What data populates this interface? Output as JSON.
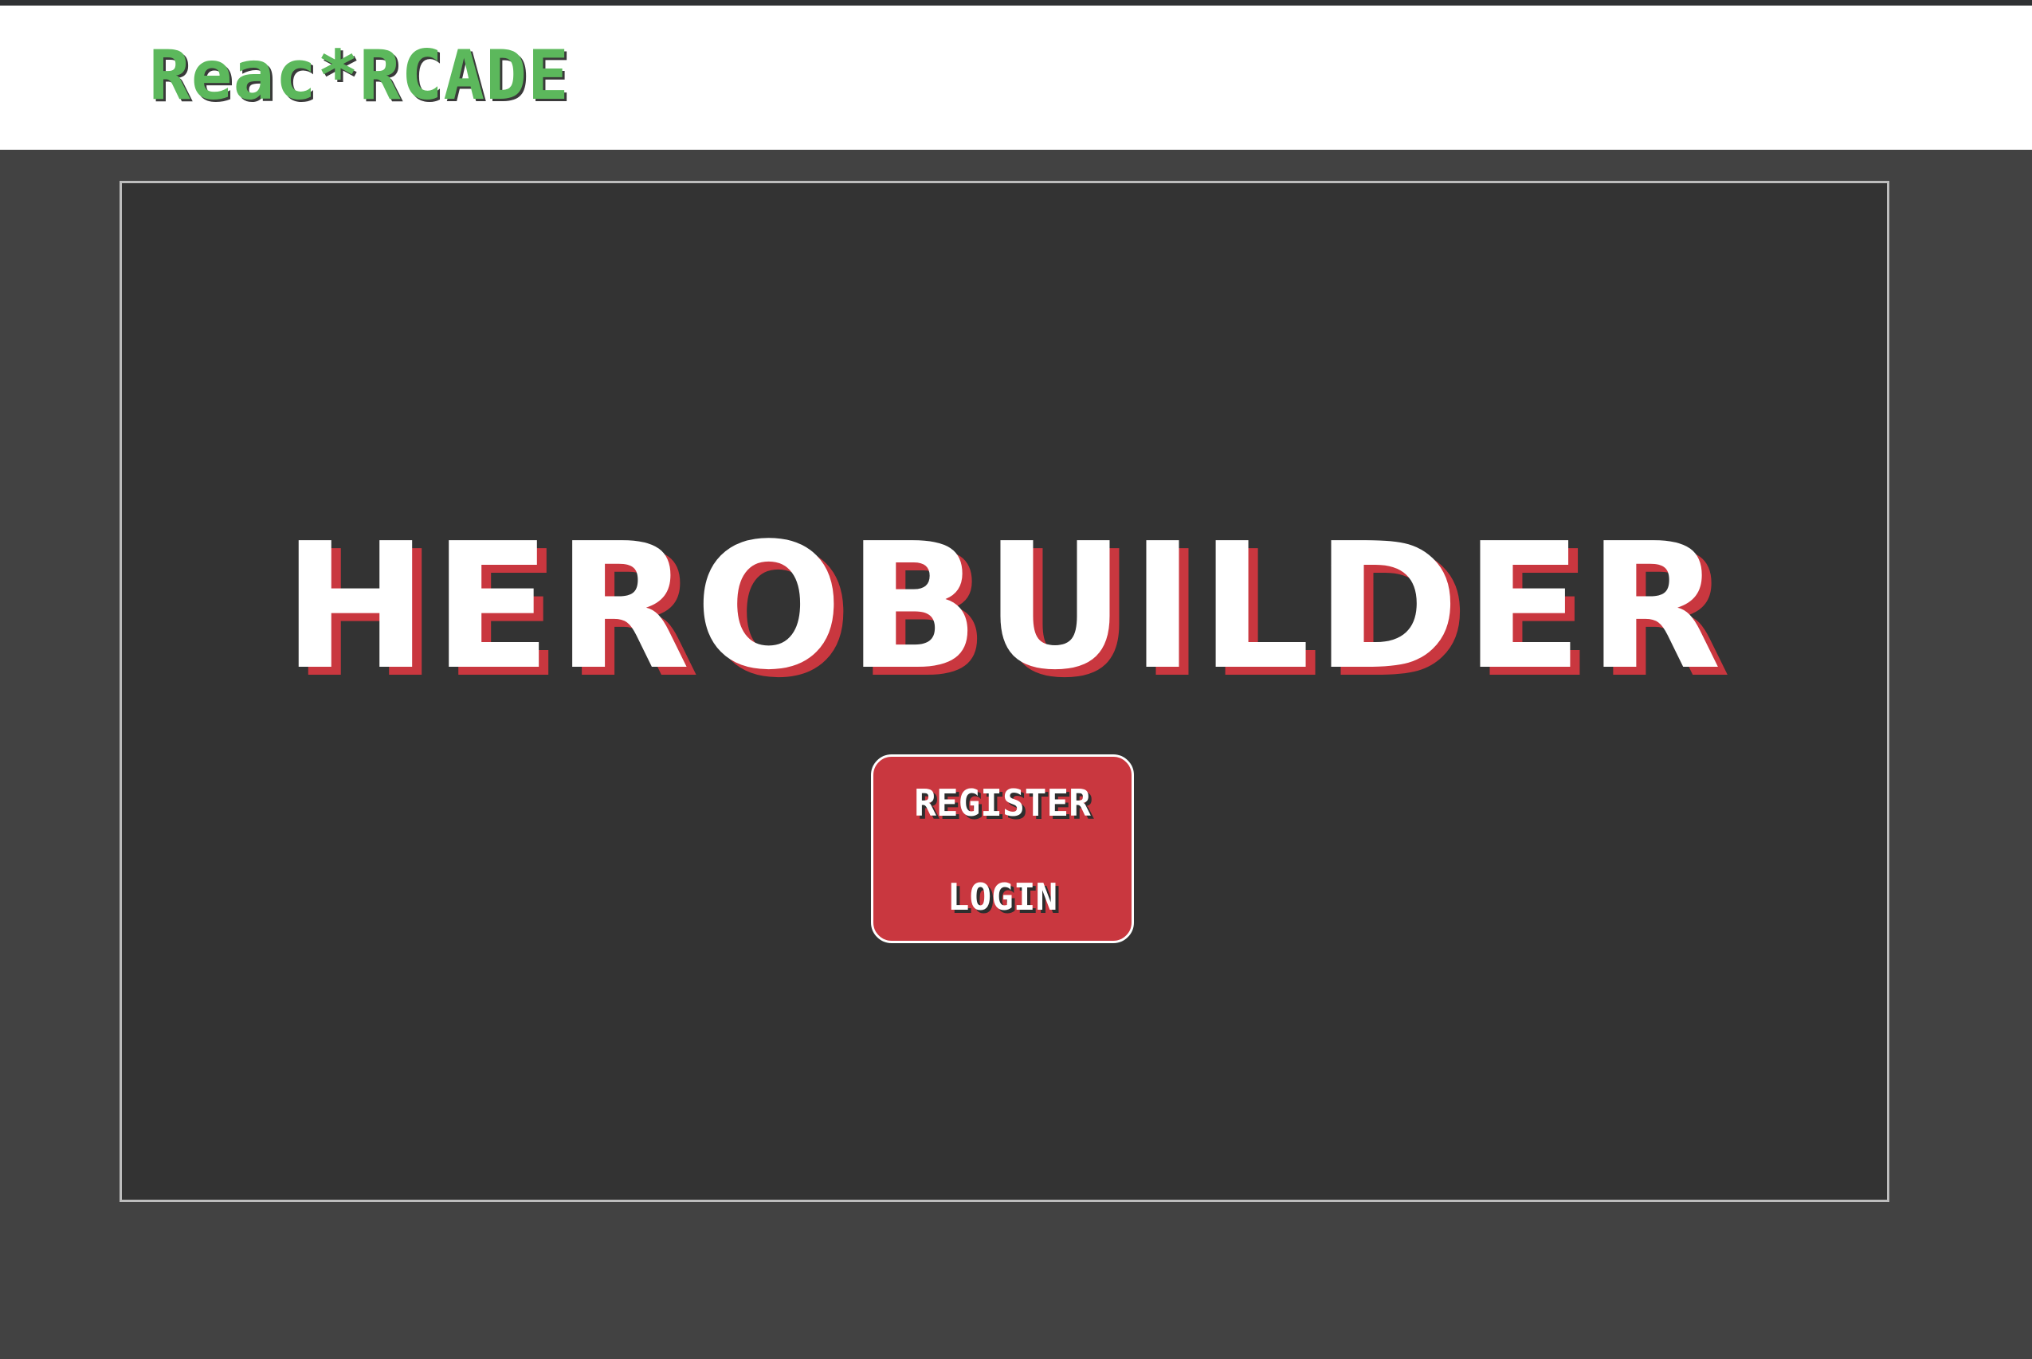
{
  "header": {
    "logo_text": "Reac*RCADE"
  },
  "game": {
    "title": "HEROBUILDER",
    "menu": {
      "register_label": "REGISTER",
      "login_label": "LOGIN"
    }
  },
  "colors": {
    "logo_green": "#5cb85c",
    "accent_red": "#c9373f",
    "page_background": "#424242",
    "frame_background": "#333333",
    "header_background": "#ffffff"
  }
}
